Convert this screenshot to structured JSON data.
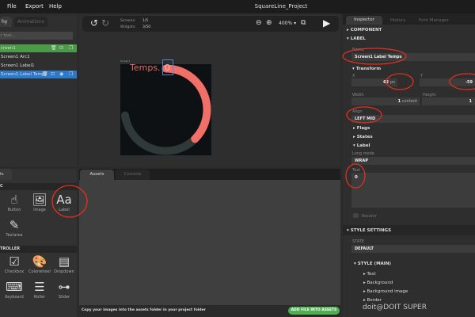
{
  "menu": {
    "items": [
      "File",
      "Export",
      "Help"
    ],
    "title": "SquareLine_Project"
  },
  "left": {
    "tabs": [
      "hy",
      "Animations"
    ],
    "search_placeholder": "r text...",
    "tree": [
      {
        "label": "creen1",
        "state": "green"
      },
      {
        "label": "Screen1 Arc1",
        "state": "normal"
      },
      {
        "label": "Screen1 Label1",
        "state": "normal"
      },
      {
        "label": "Screen1 Label Temps",
        "state": "selected"
      }
    ],
    "widgets_tab": "ts",
    "sections": [
      "C",
      "TROLLER"
    ],
    "basic": [
      {
        "label": "Button",
        "icon": "button-icon"
      },
      {
        "label": "Image",
        "icon": "image-icon"
      },
      {
        "label": "Label",
        "icon": "label-icon",
        "glyph": "Aa"
      },
      {
        "label": "Textarea",
        "icon": "textarea-icon"
      }
    ],
    "controller": [
      {
        "label": "Checkbox",
        "icon": "checkbox-icon"
      },
      {
        "label": "Colorwheel",
        "icon": "palette-icon"
      },
      {
        "label": "Dropdown",
        "icon": "dropdown-icon"
      },
      {
        "label": "Keyboard",
        "icon": "keyboard-icon"
      },
      {
        "label": "Roller",
        "icon": "roller-icon"
      },
      {
        "label": "Slider",
        "icon": "slider-icon"
      }
    ]
  },
  "toolbar": {
    "screens_label": "Screens:",
    "screens_value": "1/5",
    "widgets_label": "Widgets:",
    "widgets_value": "3/50",
    "zoom": "400%"
  },
  "canvas": {
    "screen_name": "Screen1",
    "label_text": "Temps.",
    "value_text": "0",
    "arc_color": "#f07068",
    "arc_bg": "#2f3a38"
  },
  "bottom": {
    "tabs": [
      "Assets",
      "Console"
    ],
    "hint": "Copy your images into the assets folder in your project folder",
    "add_button": "ADD FILE INTO ASSETS"
  },
  "inspector": {
    "tabs": [
      "Inspector",
      "History",
      "Font Manager"
    ],
    "component": "COMPONENT",
    "label_section": "LABEL",
    "name_label": "Name",
    "name_value": "Screen1 Label Temps",
    "transform": "Transform",
    "x_label": "X",
    "x_value": "62",
    "x_unit": "px",
    "y_label": "Y",
    "y_value": "-59",
    "width_label": "Width",
    "width_value": "1",
    "width_unit": "content",
    "height_label": "Height",
    "height_value": "1",
    "align_label": "Align",
    "align_value": "LEFT MID",
    "flags": "Flags",
    "states": "States",
    "label_sub": "Label",
    "long_mode_label": "Long mode",
    "long_mode_value": "WRAP",
    "text_label": "Text",
    "text_value": "0",
    "recolor": "Recolor",
    "style_settings": "STYLE SETTINGS",
    "state_label": "STATE",
    "state_value": "DEFAULT",
    "style_main": "STYLE (MAIN)",
    "style_items": [
      "Text",
      "Background",
      "Background image",
      "Border"
    ]
  },
  "watermark": "doit@DOIT SUPER"
}
